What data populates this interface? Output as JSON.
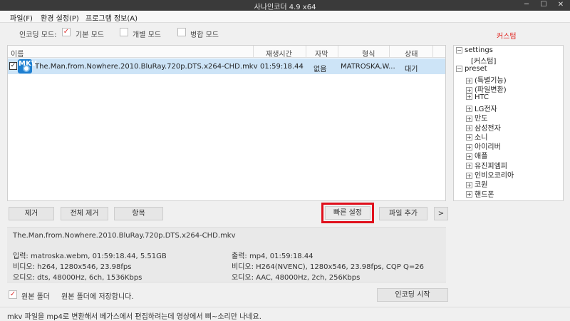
{
  "window": {
    "title": "사나인코더 4.9 x64",
    "min": "─",
    "max": "☐",
    "close": "✕"
  },
  "menu": {
    "file": "파일(F)",
    "settings": "환경 설정(P)",
    "info": "프로그램 정보(A)"
  },
  "mode": {
    "label": "인코딩 모드:",
    "basic": "기본 모드",
    "basic_checked": "✓",
    "individual": "개별 모드",
    "mixed": "병합 모드",
    "custom": "커스텀"
  },
  "filelist": {
    "headers": {
      "name": "이름",
      "duration": "재생시간",
      "subtitle": "자막",
      "format": "형식",
      "status": "상태"
    },
    "row": {
      "checked": "✓",
      "icon_text": "MKV",
      "name": "The.Man.from.Nowhere.2010.BluRay.720p.DTS.x264-CHD.mkv",
      "duration": "01:59:18.44",
      "subtitle": "없음",
      "format": "MATROSKA,W...",
      "status": "대기"
    }
  },
  "tree": {
    "settings": "settings",
    "custom": "[커스텀]",
    "preset": "preset",
    "items": [
      "(특별기능)",
      "(파일변환)",
      "HTC",
      "LG전자",
      "만도",
      "삼성전자",
      "소니",
      "아이리버",
      "애플",
      "유진피엠피",
      "인비오코리아",
      "코원",
      "핸드폰"
    ],
    "expand_minus": "−",
    "expand_plus": "+"
  },
  "buttons": {
    "remove": "제거",
    "remove_all": "전체 제거",
    "item": "항목",
    "quick_settings": "빠른 설정",
    "add_file": "파일 추가",
    "more": ">",
    "start": "인코딩 시작"
  },
  "info": {
    "filename": "The.Man.from.Nowhere.2010.BluRay.720p.DTS.x264-CHD.mkv",
    "input": "입력: matroska.webm, 01:59:18.44, 5.51GB",
    "output": "출력: mp4, 01:59:18.44",
    "video_in": "비디오: h264, 1280x546, 23.98fps",
    "video_out": "비디오: H264(NVENC), 1280x546, 23.98fps, CQP Q=26",
    "audio_in": "오디오: dts, 48000Hz, 6ch, 1536Kbps",
    "audio_out": "오디오: AAC, 48000Hz, 2ch, 256Kbps"
  },
  "bottom": {
    "source_folder_checked": "✓",
    "source_folder": "원본 폴더",
    "save_note": "원본 폴더에 저장합니다."
  },
  "status": "mkv 파일을 mp4로 변환해서 베가스에서 편집하려는데 영상에서 삐~소리만 나네요.",
  "colors": {
    "accent_red": "#e0201b",
    "selected_row": "#cde4f7",
    "titlebar": "#3a3a3a"
  }
}
